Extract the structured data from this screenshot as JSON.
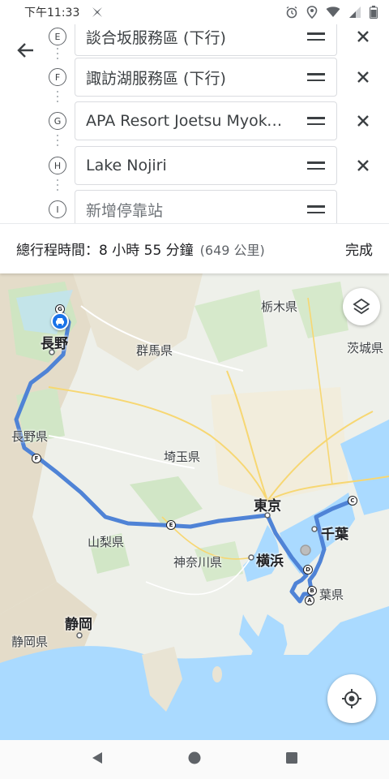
{
  "status_bar": {
    "time": "下午11:33",
    "icons": [
      "app-notification-icon",
      "alarm-icon",
      "location-icon",
      "wifi-icon",
      "signal-icon",
      "battery-icon"
    ]
  },
  "route": {
    "stops": [
      {
        "marker": "E",
        "name": "談合坂服務區 (下行)"
      },
      {
        "marker": "F",
        "name": "諏訪湖服務區 (下行)"
      },
      {
        "marker": "G",
        "name": "APA Resort Joetsu Myokou Hotel"
      },
      {
        "marker": "H",
        "name": "Lake Nojiri"
      },
      {
        "marker": "I",
        "placeholder": "新增停靠站"
      }
    ]
  },
  "summary": {
    "total": "總行程時間：8 小時 55 分鐘",
    "distance": "(649 公里)",
    "done": "完成"
  },
  "map": {
    "labels": {
      "tochigi": "栃木県",
      "gunma": "群馬県",
      "ibaraki": "茨城県",
      "nagano_city": "長野",
      "nagano_pref": "長野県",
      "saitama": "埼玉県",
      "tokyo": "東京",
      "chiba_city": "千葉",
      "chiba_pref": "葉県",
      "yamanashi": "山梨県",
      "yokohama": "横浜",
      "kanagawa": "神奈川県",
      "shizuoka_city": "静岡",
      "shizuoka_pref": "静岡県"
    },
    "waypoints": [
      "A",
      "B",
      "C",
      "D",
      "E",
      "F",
      "G"
    ],
    "colors": {
      "route": "#4f83d6",
      "water": "#aadaff",
      "land": "#eef0ea",
      "forest": "#cde5c0",
      "mountain": "#e6dcc8"
    }
  }
}
